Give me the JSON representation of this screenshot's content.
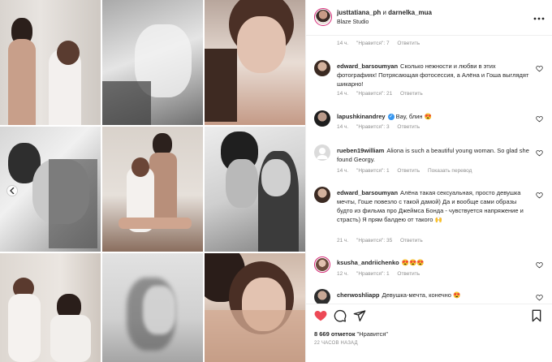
{
  "post": {
    "authors": "justtatiana_ph",
    "coauthor_connector": "и",
    "coauthor": "darnelka_mua",
    "location": "Blaze Studio",
    "more_icon": "more-icon"
  },
  "top_meta": {
    "time": "14 ч.",
    "likes": "\"Нравится\": 7",
    "reply": "Ответить"
  },
  "comments": [
    {
      "user": "edward_barsoumyan",
      "text": "Сколько нежности и любви в этих фотографиях! Потрясающая фотосессия, а Алёна и Гоша выглядят шикарно!",
      "time": "14 ч.",
      "likes": "\"Нравится\": 21",
      "reply": "Ответить"
    },
    {
      "user": "lapushkinandrey",
      "text": "Вау, блин 😍",
      "time": "14 ч.",
      "likes": "\"Нравится\": 3",
      "reply": "Ответить"
    },
    {
      "user": "rueben19william",
      "text": "Aliona is such a beautiful young woman. So glad she found Georgy.",
      "time": "14 ч.",
      "likes": "\"Нравится\": 1",
      "reply": "Ответить",
      "translate": "Показать перевод"
    },
    {
      "user": "edward_barsoumyan",
      "text": "Алёна такая сексуальная, просто девушка мечты, Гоше повезло с такой дамой) Да и вообще сами образы будто из фильма про Джеймса Бонда - чувствуется напряжение и страсть) Я прям балдею от такого 🙌",
      "time": "21 ч.",
      "likes": "\"Нравится\": 35",
      "reply": "Ответить"
    },
    {
      "user": "ksusha_andriichenko",
      "text": "😍😍😍",
      "time": "12 ч.",
      "likes": "\"Нравится\": 1",
      "reply": "Ответить"
    },
    {
      "user": "cherwoshliapp",
      "text": "Девушка-мечта, конечно 😍",
      "time": "",
      "likes": "",
      "reply": ""
    }
  ],
  "actions": {
    "like_icon": "heart-filled-icon",
    "comment_icon": "comment-icon",
    "share_icon": "share-icon",
    "save_icon": "bookmark-icon"
  },
  "likes_count": "8 669 отметок",
  "likes_label": "\"Нравится\"",
  "time_ago": "22 ЧАСОВ НАЗАД",
  "colors": {
    "like_red": "#ed4956",
    "text": "#262626",
    "muted": "#8e8e8e",
    "link": "#3897f0"
  }
}
